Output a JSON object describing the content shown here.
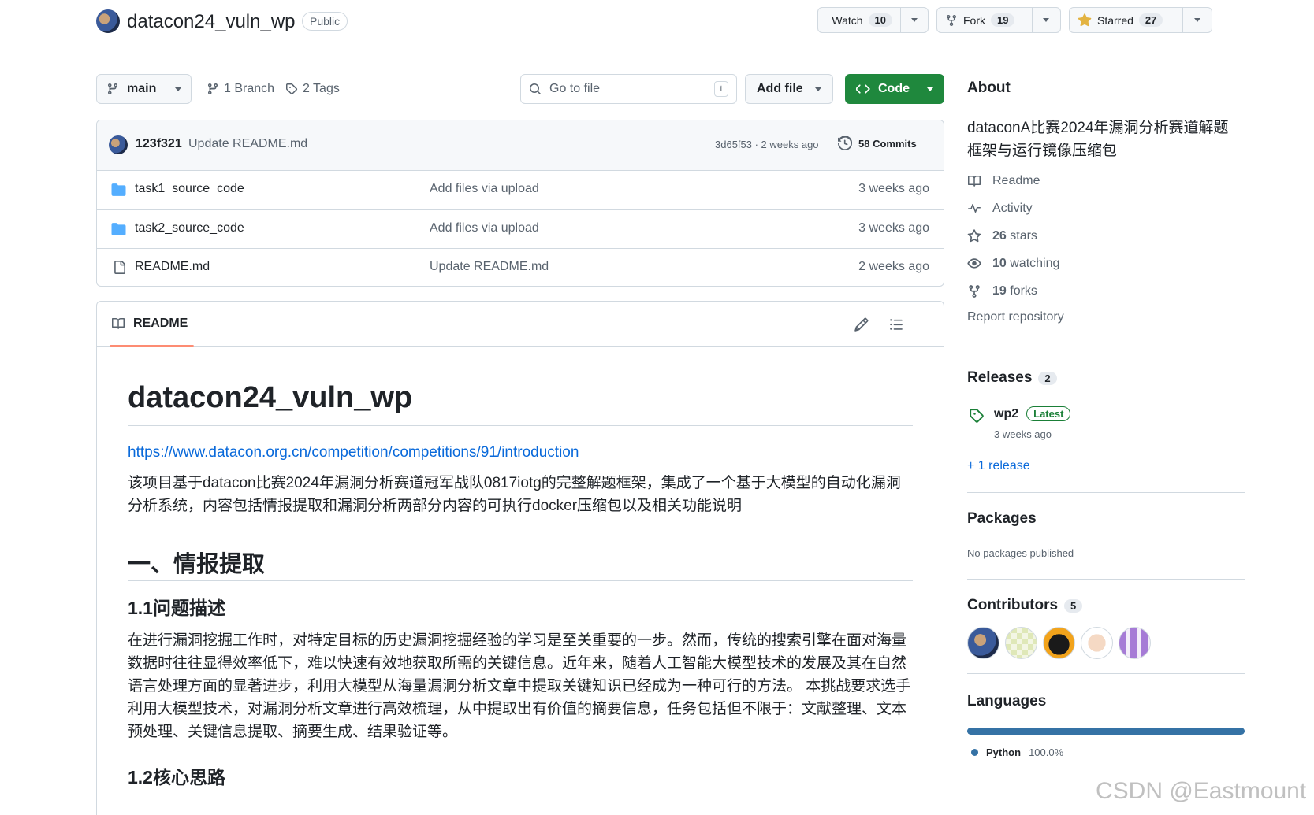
{
  "repo": {
    "name": "datacon24_vuln_wp",
    "visibility": "Public"
  },
  "actions": {
    "watch_label": "Watch",
    "watch_count": "10",
    "fork_label": "Fork",
    "fork_count": "19",
    "star_label": "Starred",
    "star_count": "27"
  },
  "toolbar": {
    "branch": "main",
    "branches": "1 Branch",
    "tags": "2 Tags",
    "search_placeholder": "Go to file",
    "search_kbd": "t",
    "add_file": "Add file",
    "code": "Code"
  },
  "commit": {
    "author": "123f321",
    "message": "Update README.md",
    "hash_time": "3d65f53 · 2 weeks ago",
    "commits": "58 Commits"
  },
  "files": [
    {
      "name": "task1_source_code",
      "type": "folder",
      "message": "Add files via upload",
      "time": "3 weeks ago"
    },
    {
      "name": "task2_source_code",
      "type": "folder",
      "message": "Add files via upload",
      "time": "3 weeks ago"
    },
    {
      "name": "README.md",
      "type": "file",
      "message": "Update README.md",
      "time": "2 weeks ago"
    }
  ],
  "readme": {
    "tab": "README",
    "title": "datacon24_vuln_wp",
    "link": "https://www.datacon.org.cn/competition/competitions/91/introduction",
    "intro": "该项目基于datacon比赛2024年漏洞分析赛道冠军战队0817iotg的完整解题框架，集成了一个基于大模型的自动化漏洞分析系统，内容包括情报提取和漏洞分析两部分内容的可执行docker压缩包以及相关功能说明",
    "h2": "一、情报提取",
    "h3_1": "1.1问题描述",
    "p1": "在进行漏洞挖掘工作时，对特定目标的历史漏洞挖掘经验的学习是至关重要的一步。然而，传统的搜索引擎在面对海量数据时往往显得效率低下，难以快速有效地获取所需的关键信息。近年来，随着人工智能大模型技术的发展及其在自然语言处理方面的显著进步，利用大模型从海量漏洞分析文章中提取关键知识已经成为一种可行的方法。 本挑战要求选手利用大模型技术，对漏洞分析文章进行高效梳理，从中提取出有价值的摘要信息，任务包括但不限于：文献整理、文本预处理、关键信息提取、摘要生成、结果验证等。",
    "h3_2": "1.2核心思路"
  },
  "about": {
    "title": "About",
    "description": "dataconA比赛2024年漏洞分析赛道解题框架与运行镜像压缩包",
    "readme": "Readme",
    "activity": "Activity",
    "stars_num": "26",
    "stars": "stars",
    "watching_num": "10",
    "watching": "watching",
    "forks_num": "19",
    "forks": "forks",
    "report": "Report repository"
  },
  "releases": {
    "title": "Releases",
    "count": "2",
    "tag": "wp2",
    "latest": "Latest",
    "time": "3 weeks ago",
    "more": "+ 1 release"
  },
  "packages": {
    "title": "Packages",
    "note": "No packages published"
  },
  "contributors": {
    "title": "Contributors",
    "count": "5"
  },
  "languages": {
    "title": "Languages",
    "name": "Python",
    "percent": "100.0%",
    "color": "#3572a5"
  },
  "watermark": "CSDN @Eastmount"
}
